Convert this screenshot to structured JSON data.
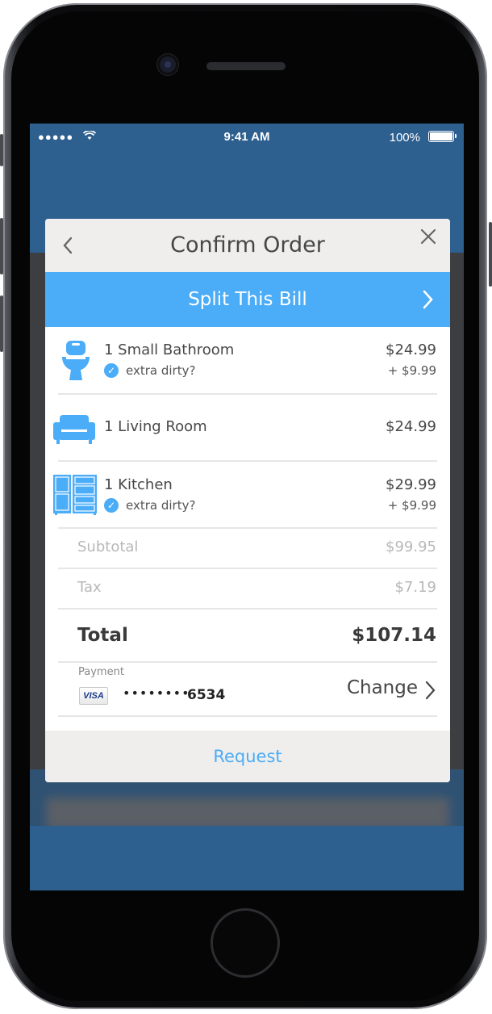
{
  "status_bar": {
    "signal": "●●●●●",
    "time": "9:41 AM",
    "battery": "100%"
  },
  "modal": {
    "title": "Confirm Order",
    "split_bill_label": "Split This Bill",
    "items": [
      {
        "name": "1 Small Bathroom",
        "price": "$24.99",
        "extra_label": "extra dirty?",
        "extra_price": "+ $9.99",
        "icon": "toilet-icon"
      },
      {
        "name": "1 Living Room",
        "price": "$24.99",
        "icon": "sofa-icon"
      },
      {
        "name": "1 Kitchen",
        "price": "$29.99",
        "extra_label": "extra dirty?",
        "extra_price": "+ $9.99",
        "icon": "kitchen-icon"
      }
    ],
    "subtotal_label": "Subtotal",
    "subtotal_value": "$99.95",
    "tax_label": "Tax",
    "tax_value": "$7.19",
    "total_label": "Total",
    "total_value": "$107.14",
    "payment_label": "Payment",
    "card_brand": "VISA",
    "card_masked": "••••••••",
    "card_last4": "6534",
    "change_label": "Change",
    "request_label": "Request"
  },
  "colors": {
    "accent": "#4bacf7",
    "header_bg": "#efeeed",
    "text": "#474747"
  }
}
